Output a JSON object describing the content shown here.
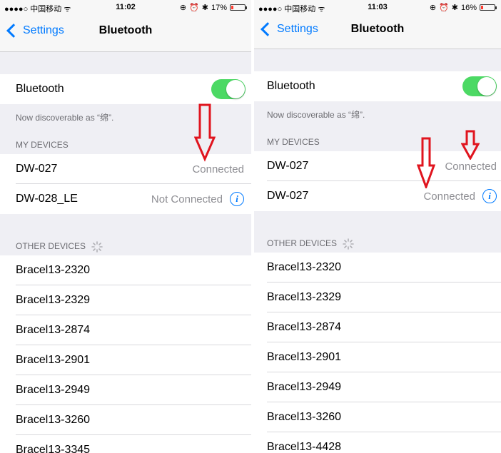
{
  "status_bar": {
    "carrier": "●●●●○ 中国移动 ᯤ",
    "time_left": "11:02",
    "battery_left": "17%",
    "time_right": "11:03",
    "battery_right": "16%",
    "icons": [
      "location-icon",
      "alarm-icon",
      "bluetooth-icon",
      "battery-icon"
    ]
  },
  "nav": {
    "back_label": "Settings",
    "title": "Bluetooth"
  },
  "bluetooth": {
    "label": "Bluetooth",
    "enabled": true,
    "discoverable": "Now discoverable as “绵”."
  },
  "sections": {
    "my_devices": "MY DEVICES",
    "other_devices": "OTHER DEVICES"
  },
  "left": {
    "my_devices": [
      {
        "name": "DW-027",
        "status": "Connected"
      },
      {
        "name": "DW-028_LE",
        "status": "Not Connected",
        "info": "i"
      }
    ],
    "other_devices": [
      "Bracel13-2320",
      "Bracel13-2329",
      "Bracel13-2874",
      "Bracel13-2901",
      "Bracel13-2949",
      "Bracel13-3260",
      "Bracel13-3345"
    ]
  },
  "right": {
    "my_devices": [
      {
        "name": "DW-027",
        "status": "Connected"
      },
      {
        "name": "DW-027",
        "status": "Connected",
        "info": "i"
      }
    ],
    "other_devices": [
      "Bracel13-2320",
      "Bracel13-2329",
      "Bracel13-2874",
      "Bracel13-2901",
      "Bracel13-2949",
      "Bracel13-3260",
      "Bracel13-4428"
    ]
  },
  "colors": {
    "accent": "#007aff",
    "toggle_on": "#4cd964",
    "annotation": "#e0141e",
    "battery_low": "#ff3b30"
  }
}
